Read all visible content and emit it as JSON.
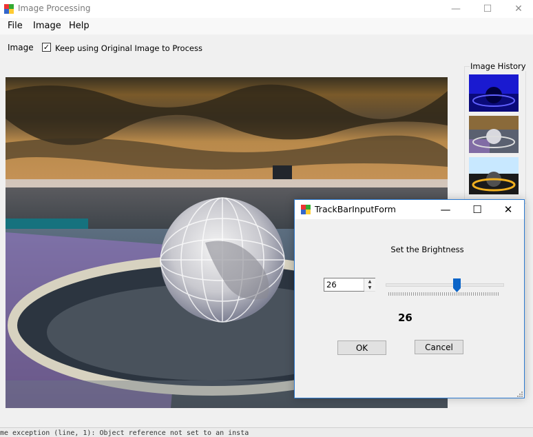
{
  "window": {
    "title": "Image Processing",
    "minimize": "—",
    "maximize": "☐",
    "close": "✕"
  },
  "menu": {
    "file": "File",
    "image": "Image",
    "help": "Help"
  },
  "toolbar": {
    "label": "Image",
    "keep_checked": "✓",
    "keep_label": "Keep using Original Image to Process"
  },
  "history": {
    "title": "Image History"
  },
  "status": {
    "text": "me exception (line, 1): Object reference not set to an insta"
  },
  "dialog": {
    "title": "TrackBarInputForm",
    "minimize": "—",
    "maximize": "☐",
    "close": "✕",
    "prompt": "Set the Brightness",
    "numeric_value": "26",
    "spin_up": "▲",
    "spin_down": "▼",
    "display_value": "26",
    "slider_level": 0.6,
    "ok_label": "OK",
    "cancel_label": "Cancel"
  },
  "colors": {
    "accent": "#2b79d0",
    "slider_thumb": "#0a64c8"
  }
}
